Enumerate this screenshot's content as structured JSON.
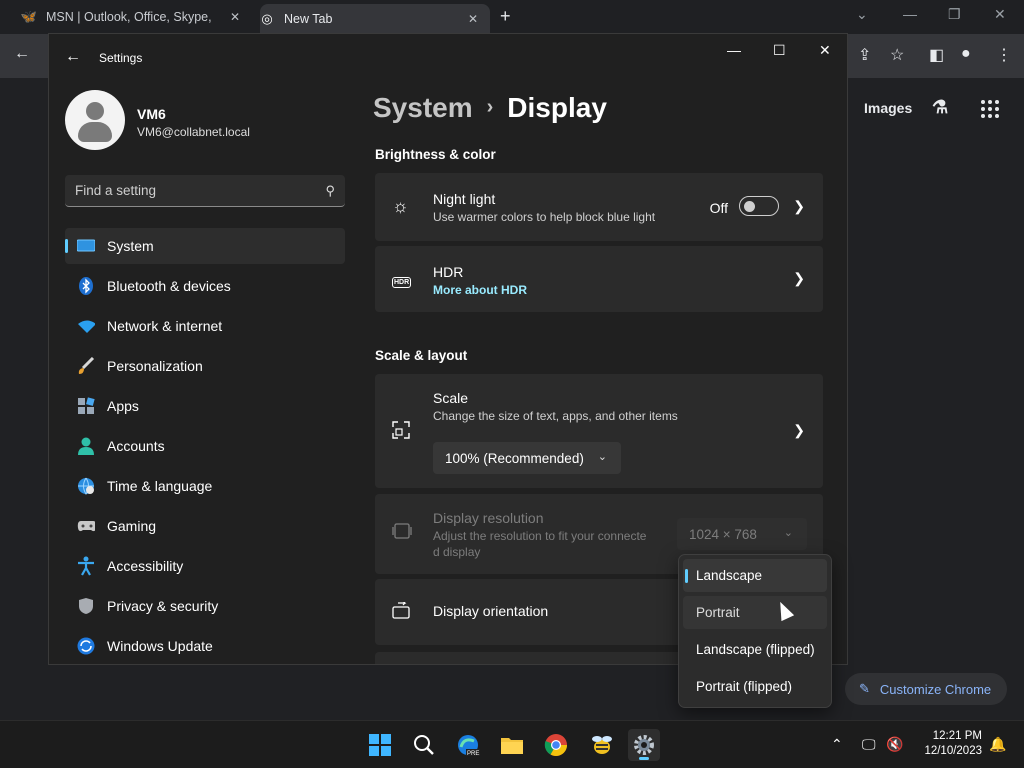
{
  "chrome": {
    "tabs": [
      {
        "title": "MSN | Outlook, Office, Skype, Bing",
        "icon": "msn-icon"
      },
      {
        "title": "New Tab",
        "icon": "chrome-icon"
      }
    ],
    "ntp": {
      "images_link": "Images"
    },
    "customize_label": "Customize Chrome"
  },
  "settings": {
    "app_title": "Settings",
    "user": {
      "name": "VM6",
      "email": "VM6@collabnet.local"
    },
    "search_placeholder": "Find a setting",
    "nav": [
      {
        "label": "System",
        "icon": "monitor-icon",
        "active": true
      },
      {
        "label": "Bluetooth & devices",
        "icon": "bluetooth-icon"
      },
      {
        "label": "Network & internet",
        "icon": "wifi-icon"
      },
      {
        "label": "Personalization",
        "icon": "brush-icon"
      },
      {
        "label": "Apps",
        "icon": "apps-icon"
      },
      {
        "label": "Accounts",
        "icon": "person-icon"
      },
      {
        "label": "Time & language",
        "icon": "globe-clock-icon"
      },
      {
        "label": "Gaming",
        "icon": "gamepad-icon"
      },
      {
        "label": "Accessibility",
        "icon": "accessibility-icon"
      },
      {
        "label": "Privacy & security",
        "icon": "shield-icon"
      },
      {
        "label": "Windows Update",
        "icon": "update-icon"
      }
    ],
    "breadcrumb": {
      "parent": "System",
      "separator": "›",
      "current": "Display"
    },
    "sections": {
      "brightness": {
        "heading": "Brightness & color",
        "night_light": {
          "title": "Night light",
          "subtitle": "Use warmer colors to help block blue light",
          "state": "Off"
        },
        "hdr": {
          "title": "HDR",
          "link": "More about HDR",
          "badge": "HDR"
        }
      },
      "scale_layout": {
        "heading": "Scale & layout",
        "scale": {
          "title": "Scale",
          "subtitle": "Change the size of text, apps, and other items",
          "value": "100% (Recommended)"
        },
        "resolution": {
          "title": "Display resolution",
          "subtitle_line1": "Adjust the resolution to fit your connecte",
          "subtitle_line2": "d display",
          "value": "1024 × 768"
        },
        "orientation": {
          "title": "Display orientation"
        }
      }
    },
    "orientation_options": [
      "Landscape",
      "Portrait",
      "Landscape (flipped)",
      "Portrait (flipped)"
    ],
    "orientation_selected": "Landscape"
  },
  "taskbar": {
    "time": "12:21 PM",
    "date": "12/10/2023"
  },
  "colors": {
    "accent": "#60cdff",
    "link": "#99ebff",
    "chrome_link": "#8ab4f8"
  }
}
